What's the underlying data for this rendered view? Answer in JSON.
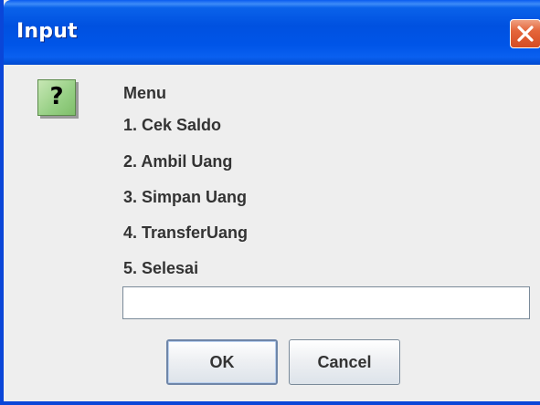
{
  "dialog": {
    "title": "Input",
    "close_icon": "close-icon",
    "message_icon": "question-icon",
    "message_icon_glyph": "?",
    "message_lines": [
      "Menu",
      "1. Cek Saldo",
      "2. Ambil Uang",
      "3. Simpan Uang",
      "4. TransferUang",
      "5. Selesai"
    ],
    "input": {
      "value": "",
      "placeholder": ""
    },
    "buttons": {
      "ok_label": "OK",
      "cancel_label": "Cancel"
    }
  },
  "colors": {
    "titlebar": "#0054e3",
    "close_button": "#e0603a",
    "icon_background": "#9fd28c",
    "dialog_background": "#eeeeee"
  }
}
